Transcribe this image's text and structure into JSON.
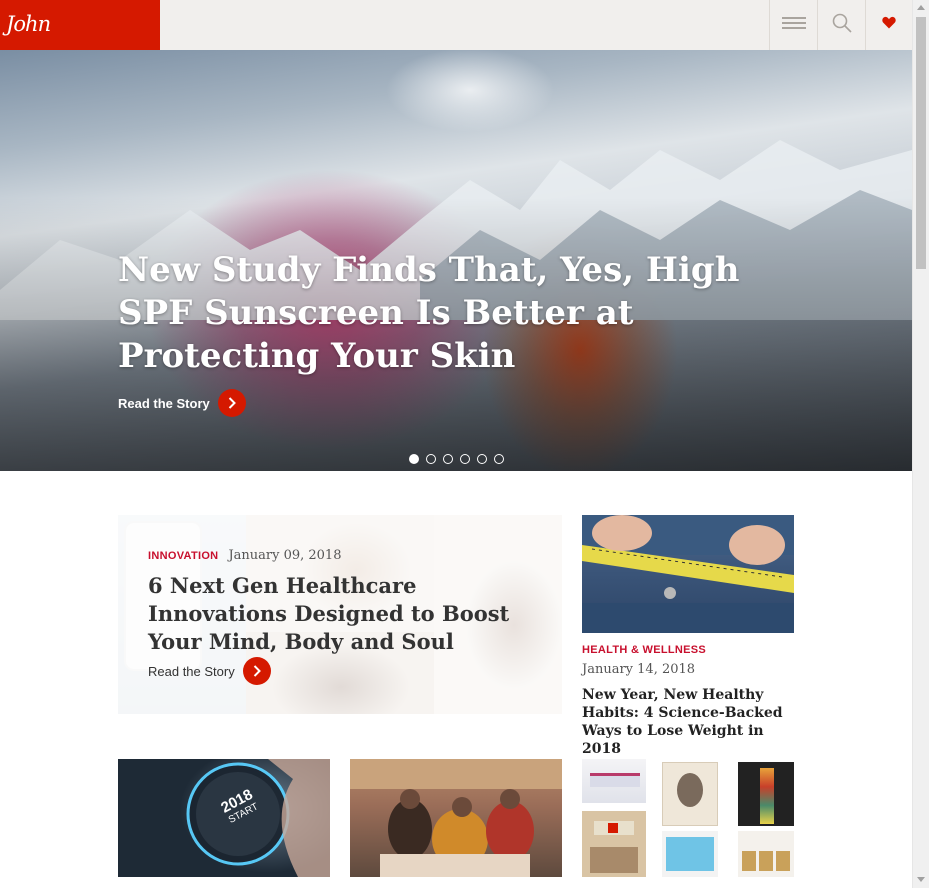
{
  "header": {
    "logo_text": "John",
    "menu_icon": "hamburger-icon",
    "search_icon": "search-icon",
    "heart_icon": "heart-icon",
    "accent_color": "#d51900"
  },
  "hero": {
    "title": "New Study Finds That, Yes, High SPF Sunscreen Is Better at Protecting Your Skin",
    "link_label": "Read the Story",
    "slide_count": 6,
    "active_slide": 1
  },
  "feature": {
    "tag": "INNOVATION",
    "date": "January 09, 2018",
    "title": "6 Next Gen Healthcare Innovations Designed to Boost Your Mind, Body and Soul",
    "link_label": "Read the Story"
  },
  "side_article": {
    "tag": "HEALTH & WELLNESS",
    "date": "January 14, 2018",
    "title": "New Year, New Healthy Habits: 4 Science-Backed Ways to Lose Weight in 2018"
  },
  "tiles": {
    "button_text_line1": "2018",
    "button_text_line2": "START"
  }
}
